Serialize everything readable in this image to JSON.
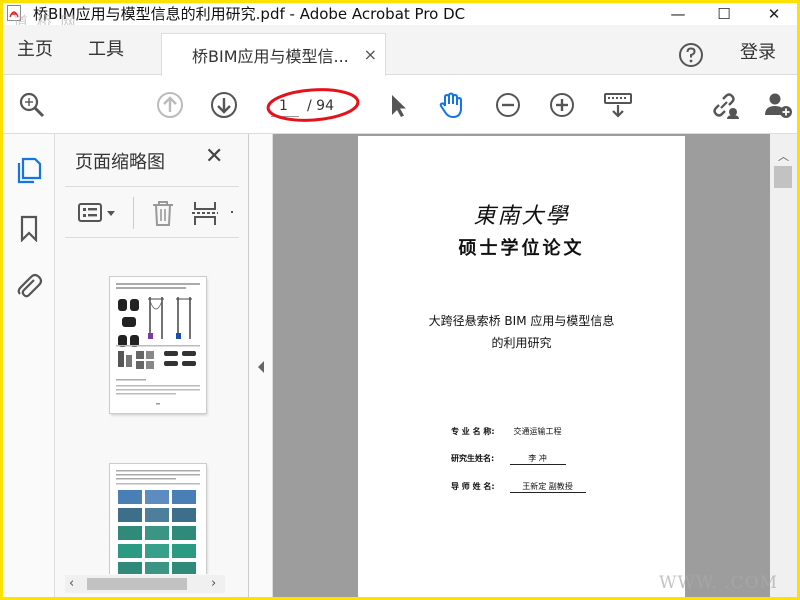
{
  "window": {
    "title": "桥BIM应用与模型信息的利用研究.pdf - Adobe Acrobat Pro DC",
    "minimize": "—",
    "maximize": "☐",
    "close": "✕",
    "app_icon": "acrobat-pdf-icon"
  },
  "watermark": {
    "top_left": "道 桥 网",
    "bottom_right": "WWW.                    .COM"
  },
  "menu": {
    "home": "主页",
    "tools": "工具",
    "doc_tab": "桥BIM应用与模型信...",
    "doc_tab_close": "×",
    "login": "登录"
  },
  "toolbar": {
    "current_page": "1",
    "total_pages": "/ 94",
    "annotation_color": "#e5121c",
    "icons": [
      "zoom-search-icon",
      "prev-page-icon",
      "next-page-icon",
      "select-cursor-icon",
      "hand-tool-icon",
      "zoom-out-icon",
      "zoom-in-icon",
      "keyboard-page-icon",
      "share-link-icon",
      "add-user-icon"
    ]
  },
  "sidebar": {
    "panel_title": "页面缩略图",
    "panel_close": "✕",
    "thumbnail_page_label": "32"
  },
  "document": {
    "university": "東南大學",
    "degree": "硕士学位论文",
    "title_line1": "大跨径悬索桥 BIM 应用与模型信息",
    "title_line2": "的利用研究",
    "major_label": "专 业 名 称:",
    "major_value": "交通运输工程",
    "author_label": "研究生姓名:",
    "author_value": "李  冲",
    "advisor_label": "导 师  姓 名:",
    "advisor_value": "王新定 副教授"
  },
  "colors": {
    "accent_blue": "#1473e6",
    "frame_yellow": "#ffe100",
    "doc_background": "#9d9d9d"
  }
}
